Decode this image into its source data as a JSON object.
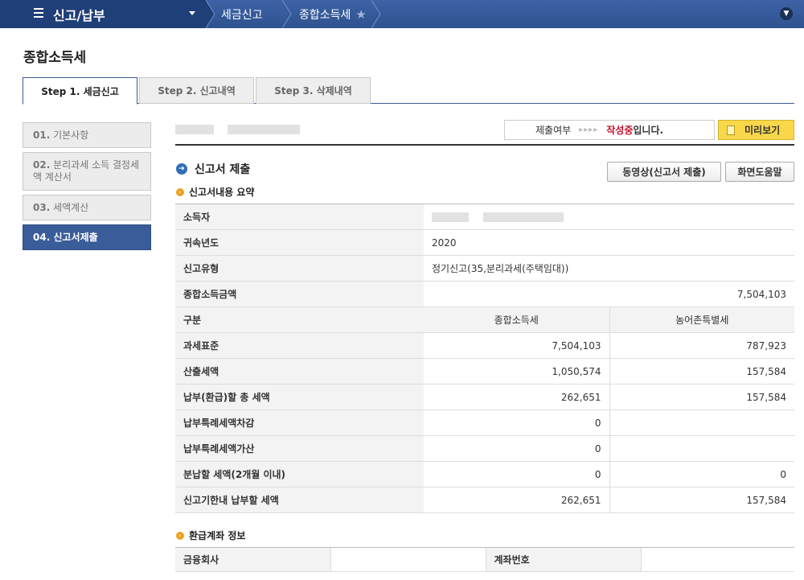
{
  "nav": {
    "menu_title": "신고/납부",
    "crumb1": "세금신고",
    "crumb2": "종합소득세"
  },
  "page_title": "종합소득세",
  "tabs": [
    "Step 1. 세금신고",
    "Step 2. 신고내역",
    "Step 3. 삭제내역"
  ],
  "sidebar": [
    {
      "num": "01.",
      "label": "기본사항"
    },
    {
      "num": "02.",
      "label": "분리과세 소득 결정세액 계산서"
    },
    {
      "num": "03.",
      "label": "세액계산"
    },
    {
      "num": "04.",
      "label": "신고서제출"
    }
  ],
  "status": {
    "label": "제출여부",
    "arrows": "▸▸▸▸",
    "state": "작성중",
    "suffix": "입니다."
  },
  "preview_button": "미리보기",
  "section_title": "신고서 제출",
  "video_button": "동영상(신고서 제출)",
  "help_button": "화면도움말",
  "summary_title": "신고서내용 요약",
  "summary": {
    "owner_label": "소득자",
    "year_label": "귀속년도",
    "year_value": "2020",
    "type_label": "신고유형",
    "type_value": "정기신고(35,분리과세(주택임대))",
    "total_label": "종합소득금액",
    "total_value": "7,504,103",
    "division_label": "구분",
    "col1": "종합소득세",
    "col2": "농어촌특별세",
    "rows": [
      {
        "label": "과세표준",
        "v1": "7,504,103",
        "v2": "787,923"
      },
      {
        "label": "산출세액",
        "v1": "1,050,574",
        "v2": "157,584"
      },
      {
        "label": "납부(환급)할 총 세액",
        "v1": "262,651",
        "v2": "157,584"
      },
      {
        "label": "납부특례세액차감",
        "v1": "0",
        "v2": ""
      },
      {
        "label": "납부특례세액가산",
        "v1": "0",
        "v2": ""
      },
      {
        "label": "분납할 세액(2개월 이내)",
        "v1": "0",
        "v2": "0"
      },
      {
        "label": "신고기한내 납부할 세액",
        "v1": "262,651",
        "v2": "157,584"
      }
    ]
  },
  "refund_title": "환급계좌 정보",
  "refund": {
    "bank_label": "금융회사",
    "account_label": "계좌번호"
  }
}
